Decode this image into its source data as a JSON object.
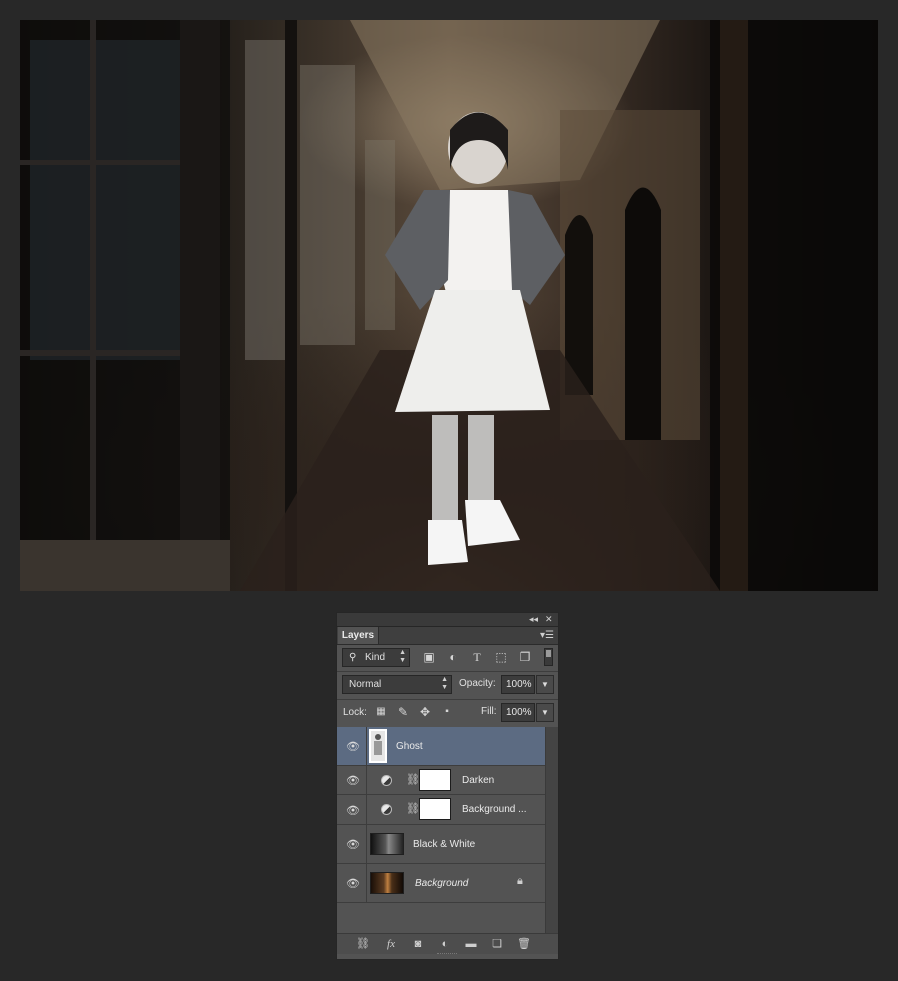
{
  "document": {
    "image_subject": "girl-in-white-dress-in-dark-hallway"
  },
  "panel": {
    "tab": "Layers",
    "filter_kind": "Kind",
    "blend_mode": "Normal",
    "opacity_label": "Opacity:",
    "opacity_value": "100%",
    "lock_label": "Lock:",
    "fill_label": "Fill:",
    "fill_value": "100%",
    "layers": [
      {
        "name": "Ghost",
        "type": "pixel",
        "selected": true
      },
      {
        "name": "Darken",
        "type": "adjustment",
        "selected": false
      },
      {
        "name": "Background ...",
        "type": "adjustment",
        "selected": false
      },
      {
        "name": "Black & White",
        "type": "pixel",
        "selected": false
      },
      {
        "name": "Background",
        "type": "background",
        "locked": true,
        "selected": false
      }
    ]
  },
  "colors": {
    "app_background": "#282828",
    "panel_background": "#535353",
    "selected_layer": "#5c6b82"
  },
  "icons": {
    "collapse": "double-chevron-left-icon",
    "close": "close-icon",
    "panel_menu": "panel-menu-icon",
    "visibility": "eye-icon",
    "lock_background": "lock-icon"
  }
}
